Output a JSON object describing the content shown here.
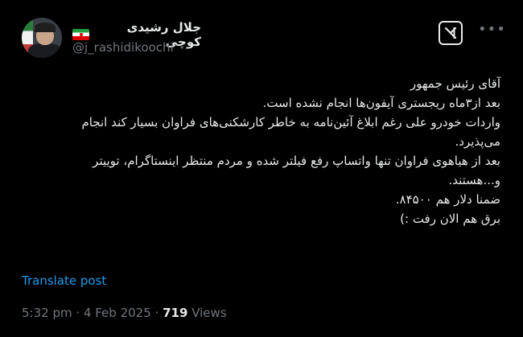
{
  "author": {
    "display_name": "جلال رشیدی کوچی",
    "handle": "@j_rashidikoochi",
    "verified_flag": "iran-flag-icon"
  },
  "tweet": {
    "lines": [
      "آقای رئیس جمهور",
      "بعد از۳ماه ریجستری آیفون‌ها انجام نشده است.",
      "واردات خودرو علی رغم ابلاغ آئین‌نامه به خاطر کارشکنی‌های فراوان بسیار کند انجام",
      "می‌پذیرد.",
      "بعد از هیاهوی فراوان تنها واتساپ رفع فیلتر شده و مردم منتظر اینستاگرام، توییتر",
      "و...هستند.",
      "ضمنا دلار هم  ۸۴۵۰۰.",
      "برق هم الان رفت :)"
    ]
  },
  "translate_label": "Translate post",
  "meta": {
    "time": "5:32 pm",
    "sep1": "·",
    "date": "4 Feb 2025",
    "sep2": "·",
    "views_count": "719",
    "views_label": "Views"
  },
  "icons": {
    "grok": "grok-icon",
    "more": "more-icon"
  },
  "colors": {
    "background": "#000000",
    "text": "#e7e9ea",
    "muted": "#71767b",
    "link": "#1d9bf0"
  }
}
